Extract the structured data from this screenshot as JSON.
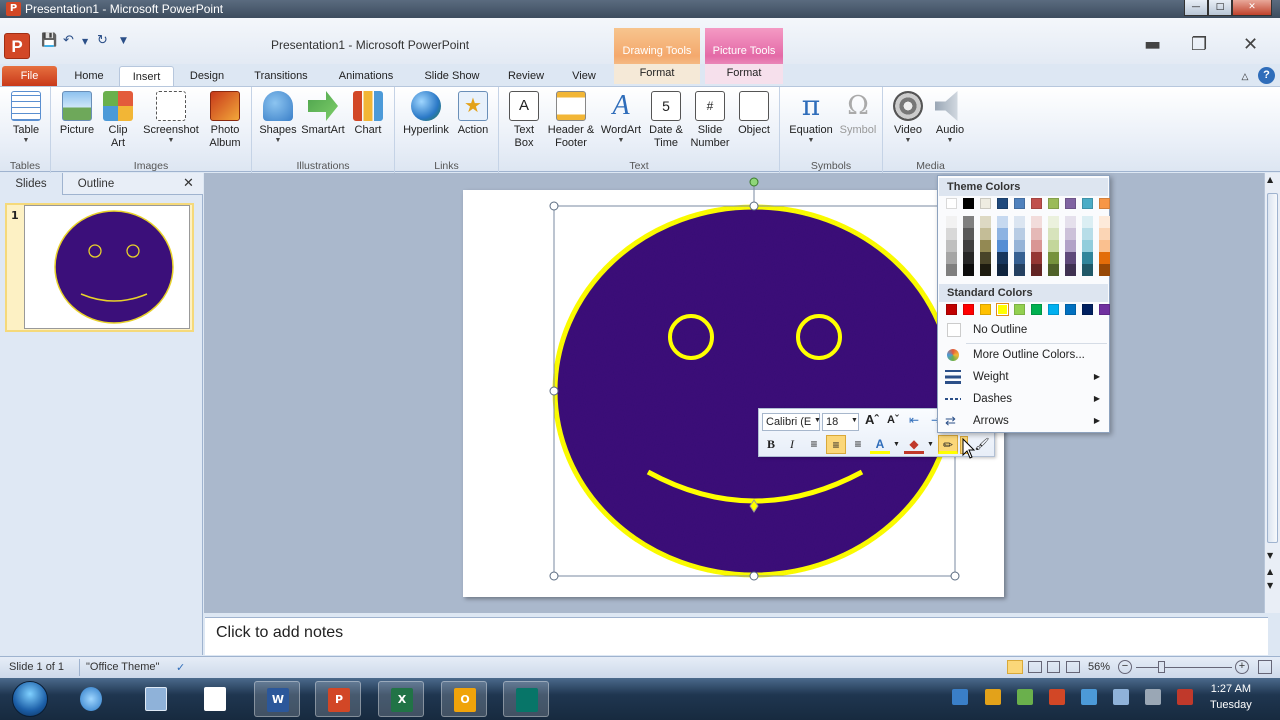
{
  "window": {
    "title": "Presentation1 - Microsoft PowerPoint",
    "app_title": "Presentation1  -  Microsoft PowerPoint",
    "logo_letter": "P"
  },
  "context_tabs": [
    {
      "group": "Drawing Tools",
      "tab": "Format"
    },
    {
      "group": "Picture Tools",
      "tab": "Format"
    }
  ],
  "tabs": [
    "File",
    "Home",
    "Insert",
    "Design",
    "Transitions",
    "Animations",
    "Slide Show",
    "Review",
    "View"
  ],
  "ribbon": {
    "groups": {
      "tables": "Tables",
      "images": "Images",
      "illustrations": "Illustrations",
      "links": "Links",
      "text": "Text",
      "symbols": "Symbols",
      "media": "Media"
    },
    "buttons": {
      "table": "Table",
      "picture": "Picture",
      "clip_art": "Clip Art",
      "screenshot": "Screenshot",
      "photo_album": "Photo Album",
      "shapes": "Shapes",
      "smartart": "SmartArt",
      "chart": "Chart",
      "hyperlink": "Hyperlink",
      "action": "Action",
      "text_box": "Text Box",
      "header_footer": "Header & Footer",
      "wordart": "WordArt",
      "date_time": "Date & Time",
      "slide_number": "Slide Number",
      "object": "Object",
      "equation": "Equation",
      "symbol": "Symbol",
      "video": "Video",
      "audio": "Audio"
    }
  },
  "slides_pane": {
    "tab_slides": "Slides",
    "tab_outline": "Outline",
    "slide_number": "1"
  },
  "notes": {
    "placeholder": "Click to add notes"
  },
  "mini_toolbar": {
    "font": "Calibri (E",
    "size": "18",
    "bold": "B",
    "italic": "I",
    "font_color_letter": "A"
  },
  "outline_menu": {
    "theme_header": "Theme Colors",
    "standard_header": "Standard Colors",
    "no_outline": "No Outline",
    "more_colors": "More Outline Colors...",
    "weight": "Weight",
    "dashes": "Dashes",
    "arrows": "Arrows",
    "theme_top": [
      "#ffffff",
      "#000000",
      "#eeece1",
      "#1f497d",
      "#4f81bd",
      "#c0504d",
      "#9bbb59",
      "#8064a2",
      "#4bacc6",
      "#f79646"
    ],
    "theme_shades": [
      [
        "#f2f2f2",
        "#7f7f7f",
        "#ddd9c3",
        "#c6d9f0",
        "#dbe5f1",
        "#f2dcdb",
        "#ebf1dd",
        "#e5e0ec",
        "#dbeef3",
        "#fdeada"
      ],
      [
        "#d8d8d8",
        "#595959",
        "#c4bd97",
        "#8db3e2",
        "#b8cce4",
        "#e5b9b7",
        "#d7e3bc",
        "#ccc1d9",
        "#b7dde8",
        "#fbd5b5"
      ],
      [
        "#bfbfbf",
        "#3f3f3f",
        "#938953",
        "#548dd4",
        "#95b3d7",
        "#d99694",
        "#c3d69b",
        "#b2a2c7",
        "#92cddc",
        "#fac08f"
      ],
      [
        "#a5a5a5",
        "#262626",
        "#494429",
        "#17365d",
        "#366092",
        "#953734",
        "#76923c",
        "#5f497a",
        "#31859b",
        "#e36c09"
      ],
      [
        "#7f7f7f",
        "#0c0c0c",
        "#1d1b10",
        "#0f243e",
        "#244061",
        "#632423",
        "#4f6128",
        "#3f3151",
        "#205867",
        "#974806"
      ]
    ],
    "standard": [
      "#c00000",
      "#ff0000",
      "#ffc000",
      "#ffff00",
      "#92d050",
      "#00b050",
      "#00b0f0",
      "#0070c0",
      "#002060",
      "#7030a0"
    ]
  },
  "status": {
    "slide": "Slide 1 of 1",
    "theme": "\"Office Theme\"",
    "zoom": "56%"
  },
  "taskbar": {
    "time": "1:27 AM",
    "day": "Tuesday"
  },
  "colors": {
    "face_fill": "#3b0f7a",
    "face_outline": "#ffff00",
    "file_tab": "#d24726"
  }
}
